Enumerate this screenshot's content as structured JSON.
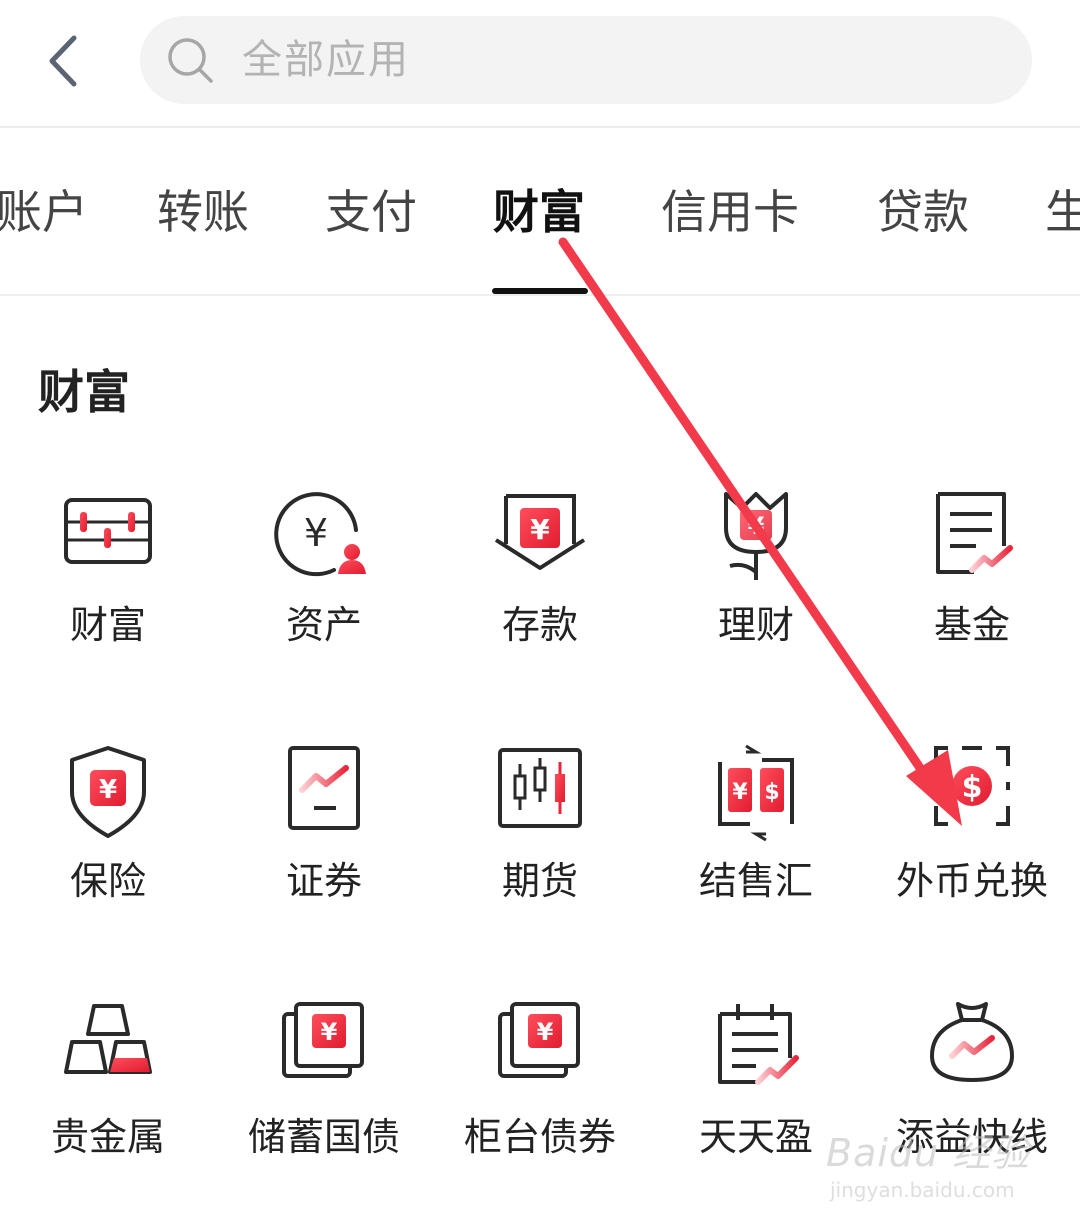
{
  "search": {
    "placeholder": "全部应用"
  },
  "tabs": [
    {
      "label": "账户"
    },
    {
      "label": "转账"
    },
    {
      "label": "支付"
    },
    {
      "label": "财富"
    },
    {
      "label": "信用卡"
    },
    {
      "label": "贷款"
    },
    {
      "label": "生"
    }
  ],
  "active_tab": "财富",
  "section": {
    "title": "财富"
  },
  "tiles": [
    {
      "label": "财富",
      "icon": "wealth-panel-icon"
    },
    {
      "label": "资产",
      "icon": "asset-icon"
    },
    {
      "label": "存款",
      "icon": "deposit-icon"
    },
    {
      "label": "理财",
      "icon": "finance-flower-icon"
    },
    {
      "label": "基金",
      "icon": "fund-icon"
    },
    {
      "label": "保险",
      "icon": "insurance-shield-icon"
    },
    {
      "label": "证券",
      "icon": "securities-icon"
    },
    {
      "label": "期货",
      "icon": "futures-candlestick-icon"
    },
    {
      "label": "结售汇",
      "icon": "exchange-settlement-icon"
    },
    {
      "label": "外币兑换",
      "icon": "foreign-currency-icon"
    },
    {
      "label": "贵金属",
      "icon": "gold-bars-icon"
    },
    {
      "label": "储蓄国债",
      "icon": "savings-bond-icon"
    },
    {
      "label": "柜台债券",
      "icon": "counter-bond-icon"
    },
    {
      "label": "天天盈",
      "icon": "daily-gain-icon"
    },
    {
      "label": "添益快线",
      "icon": "money-bag-icon"
    }
  ],
  "watermark": {
    "brand": "Baidu 经验",
    "url": "jingyan.baidu.com"
  },
  "colors": {
    "accent_red": "#e8253a",
    "annotation_arrow": "#f23a4a",
    "icon_stroke": "#2a2a2a"
  }
}
